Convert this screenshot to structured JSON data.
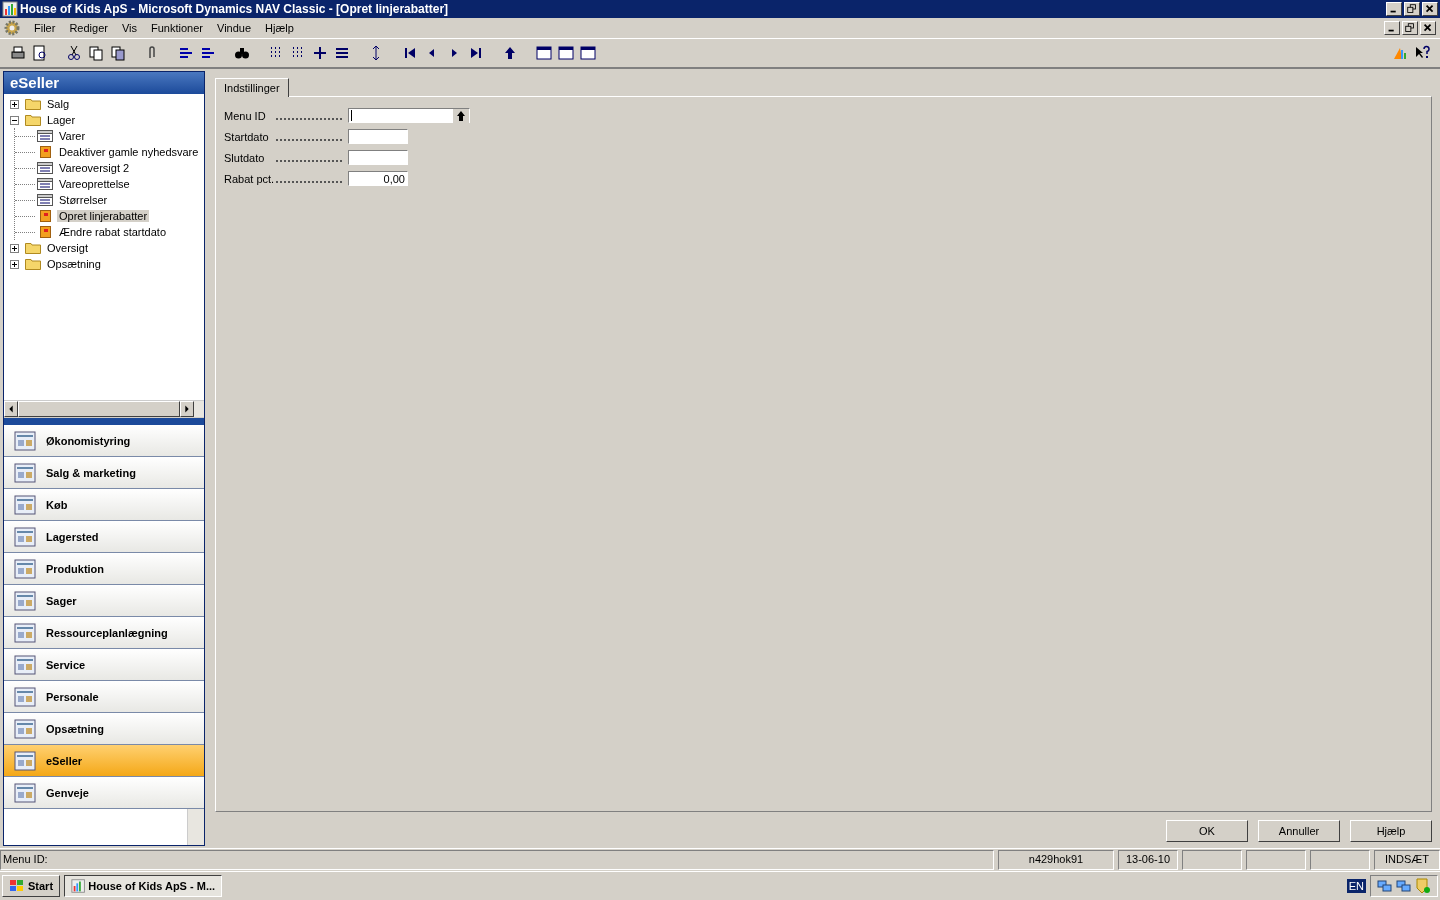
{
  "window": {
    "title": "House of Kids ApS - Microsoft Dynamics NAV Classic - [Opret linjerabatter]"
  },
  "menu": [
    "Filer",
    "Rediger",
    "Vis",
    "Funktioner",
    "Vindue",
    "Hjælp"
  ],
  "sidebar": {
    "title": "eSeller",
    "tree": [
      {
        "label": "Salg",
        "kind": "folder",
        "expanded": false,
        "selected": false
      },
      {
        "label": "Lager",
        "kind": "folder",
        "expanded": true,
        "selected": false,
        "children": [
          {
            "label": "Varer",
            "kind": "list",
            "selected": false
          },
          {
            "label": "Deaktiver gamle nyhedsvare",
            "kind": "report",
            "selected": false
          },
          {
            "label": "Vareoversigt 2",
            "kind": "list",
            "selected": false
          },
          {
            "label": "Vareoprettelse",
            "kind": "list",
            "selected": false
          },
          {
            "label": "Størrelser",
            "kind": "list",
            "selected": false
          },
          {
            "label": "Opret linjerabatter",
            "kind": "report",
            "selected": true
          },
          {
            "label": "Ændre rabat startdato",
            "kind": "report",
            "selected": false
          }
        ]
      },
      {
        "label": "Oversigt",
        "kind": "folder",
        "expanded": false,
        "selected": false
      },
      {
        "label": "Opsætning",
        "kind": "folder",
        "expanded": false,
        "selected": false
      }
    ],
    "nav": [
      {
        "label": "Økonomistyring",
        "selected": false
      },
      {
        "label": "Salg & marketing",
        "selected": false
      },
      {
        "label": "Køb",
        "selected": false
      },
      {
        "label": "Lagersted",
        "selected": false
      },
      {
        "label": "Produktion",
        "selected": false
      },
      {
        "label": "Sager",
        "selected": false
      },
      {
        "label": "Ressourceplanlægning",
        "selected": false
      },
      {
        "label": "Service",
        "selected": false
      },
      {
        "label": "Personale",
        "selected": false
      },
      {
        "label": "Opsætning",
        "selected": false
      },
      {
        "label": "eSeller",
        "selected": true
      },
      {
        "label": "Genveje",
        "selected": false
      }
    ]
  },
  "tabs": [
    {
      "label": "Indstillinger",
      "selected": true
    }
  ],
  "fields": [
    {
      "label": "Menu ID",
      "kind": "lookup"
    },
    {
      "label": "Startdato",
      "kind": "text"
    },
    {
      "label": "Slutdato",
      "kind": "text"
    },
    {
      "label": "Rabat pct.",
      "kind": "number",
      "value": "0,00"
    }
  ],
  "buttons": [
    "OK",
    "Annuller",
    "Hjælp"
  ],
  "status_bar": {
    "message": "Menu ID:",
    "user": "n429hok91",
    "date": "13-06-10",
    "mode": "INDSÆT"
  },
  "taskbar": {
    "start": "Start",
    "task": "House of Kids ApS - M...",
    "language": "EN"
  }
}
